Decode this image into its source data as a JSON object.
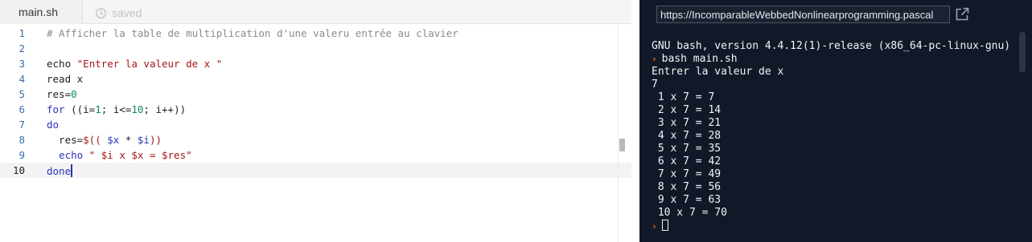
{
  "editor": {
    "file_tab": "main.sh",
    "saved_label": "saved",
    "lines": [
      {
        "number": "1",
        "tokens": [
          {
            "t": "# Afficher la table de multiplication d'une valeru entrée au clavier",
            "c": "comment"
          }
        ]
      },
      {
        "number": "2",
        "tokens": []
      },
      {
        "number": "3",
        "tokens": [
          {
            "t": "echo ",
            "c": "plain"
          },
          {
            "t": "\"Entrer la valeur de x \"",
            "c": "str"
          }
        ]
      },
      {
        "number": "4",
        "tokens": [
          {
            "t": "read x",
            "c": "plain"
          }
        ]
      },
      {
        "number": "5",
        "tokens": [
          {
            "t": "res=",
            "c": "plain"
          },
          {
            "t": "0",
            "c": "num"
          }
        ]
      },
      {
        "number": "6",
        "tokens": [
          {
            "t": "for",
            "c": "key"
          },
          {
            "t": " ((i=",
            "c": "plain"
          },
          {
            "t": "1",
            "c": "num"
          },
          {
            "t": "; i<=",
            "c": "plain"
          },
          {
            "t": "10",
            "c": "num"
          },
          {
            "t": "; i++))",
            "c": "plain"
          }
        ]
      },
      {
        "number": "7",
        "tokens": [
          {
            "t": "do",
            "c": "key"
          }
        ]
      },
      {
        "number": "8",
        "tokens": [
          {
            "t": "  res=",
            "c": "plain"
          },
          {
            "t": "$((",
            "c": "str"
          },
          {
            "t": " ",
            "c": "plain"
          },
          {
            "t": "$x",
            "c": "var"
          },
          {
            "t": " * ",
            "c": "plain"
          },
          {
            "t": "$i",
            "c": "var"
          },
          {
            "t": "))",
            "c": "str"
          }
        ]
      },
      {
        "number": "9",
        "tokens": [
          {
            "t": "  ",
            "c": "plain"
          },
          {
            "t": "echo",
            "c": "key"
          },
          {
            "t": " ",
            "c": "plain"
          },
          {
            "t": "\" $i x $x = $res\"",
            "c": "str"
          }
        ]
      },
      {
        "number": "10",
        "tokens": [
          {
            "t": "done",
            "c": "key"
          }
        ],
        "active": true
      }
    ]
  },
  "terminal": {
    "url": "https://IncomparableWebbedNonlinearprogramming.pascal",
    "output": [
      {
        "text": "GNU bash, version 4.4.12(1)-release (x86_64-pc-linux-gnu)"
      },
      {
        "text": "bash main.sh",
        "prompt": true
      },
      {
        "text": "Entrer la valeur de x"
      },
      {
        "text": "7"
      },
      {
        "text": " 1 x 7 = 7"
      },
      {
        "text": " 2 x 7 = 14"
      },
      {
        "text": " 3 x 7 = 21"
      },
      {
        "text": " 4 x 7 = 28"
      },
      {
        "text": " 5 x 7 = 35"
      },
      {
        "text": " 6 x 7 = 42"
      },
      {
        "text": " 7 x 7 = 49"
      },
      {
        "text": " 8 x 7 = 56"
      },
      {
        "text": " 9 x 7 = 63"
      },
      {
        "text": " 10 x 7 = 70"
      },
      {
        "text": "",
        "prompt": true,
        "cursor": true
      }
    ],
    "prompt_symbol": "›",
    "icons": {
      "open_tab": "external-link-icon",
      "saved": "saved-clock-icon"
    }
  },
  "colors": {
    "terminal_bg": "#111827",
    "prompt": "#f97316",
    "keyword": "#2b34b8",
    "string": "#a31515",
    "number": "#09885a",
    "comment": "#8a8a8a"
  }
}
